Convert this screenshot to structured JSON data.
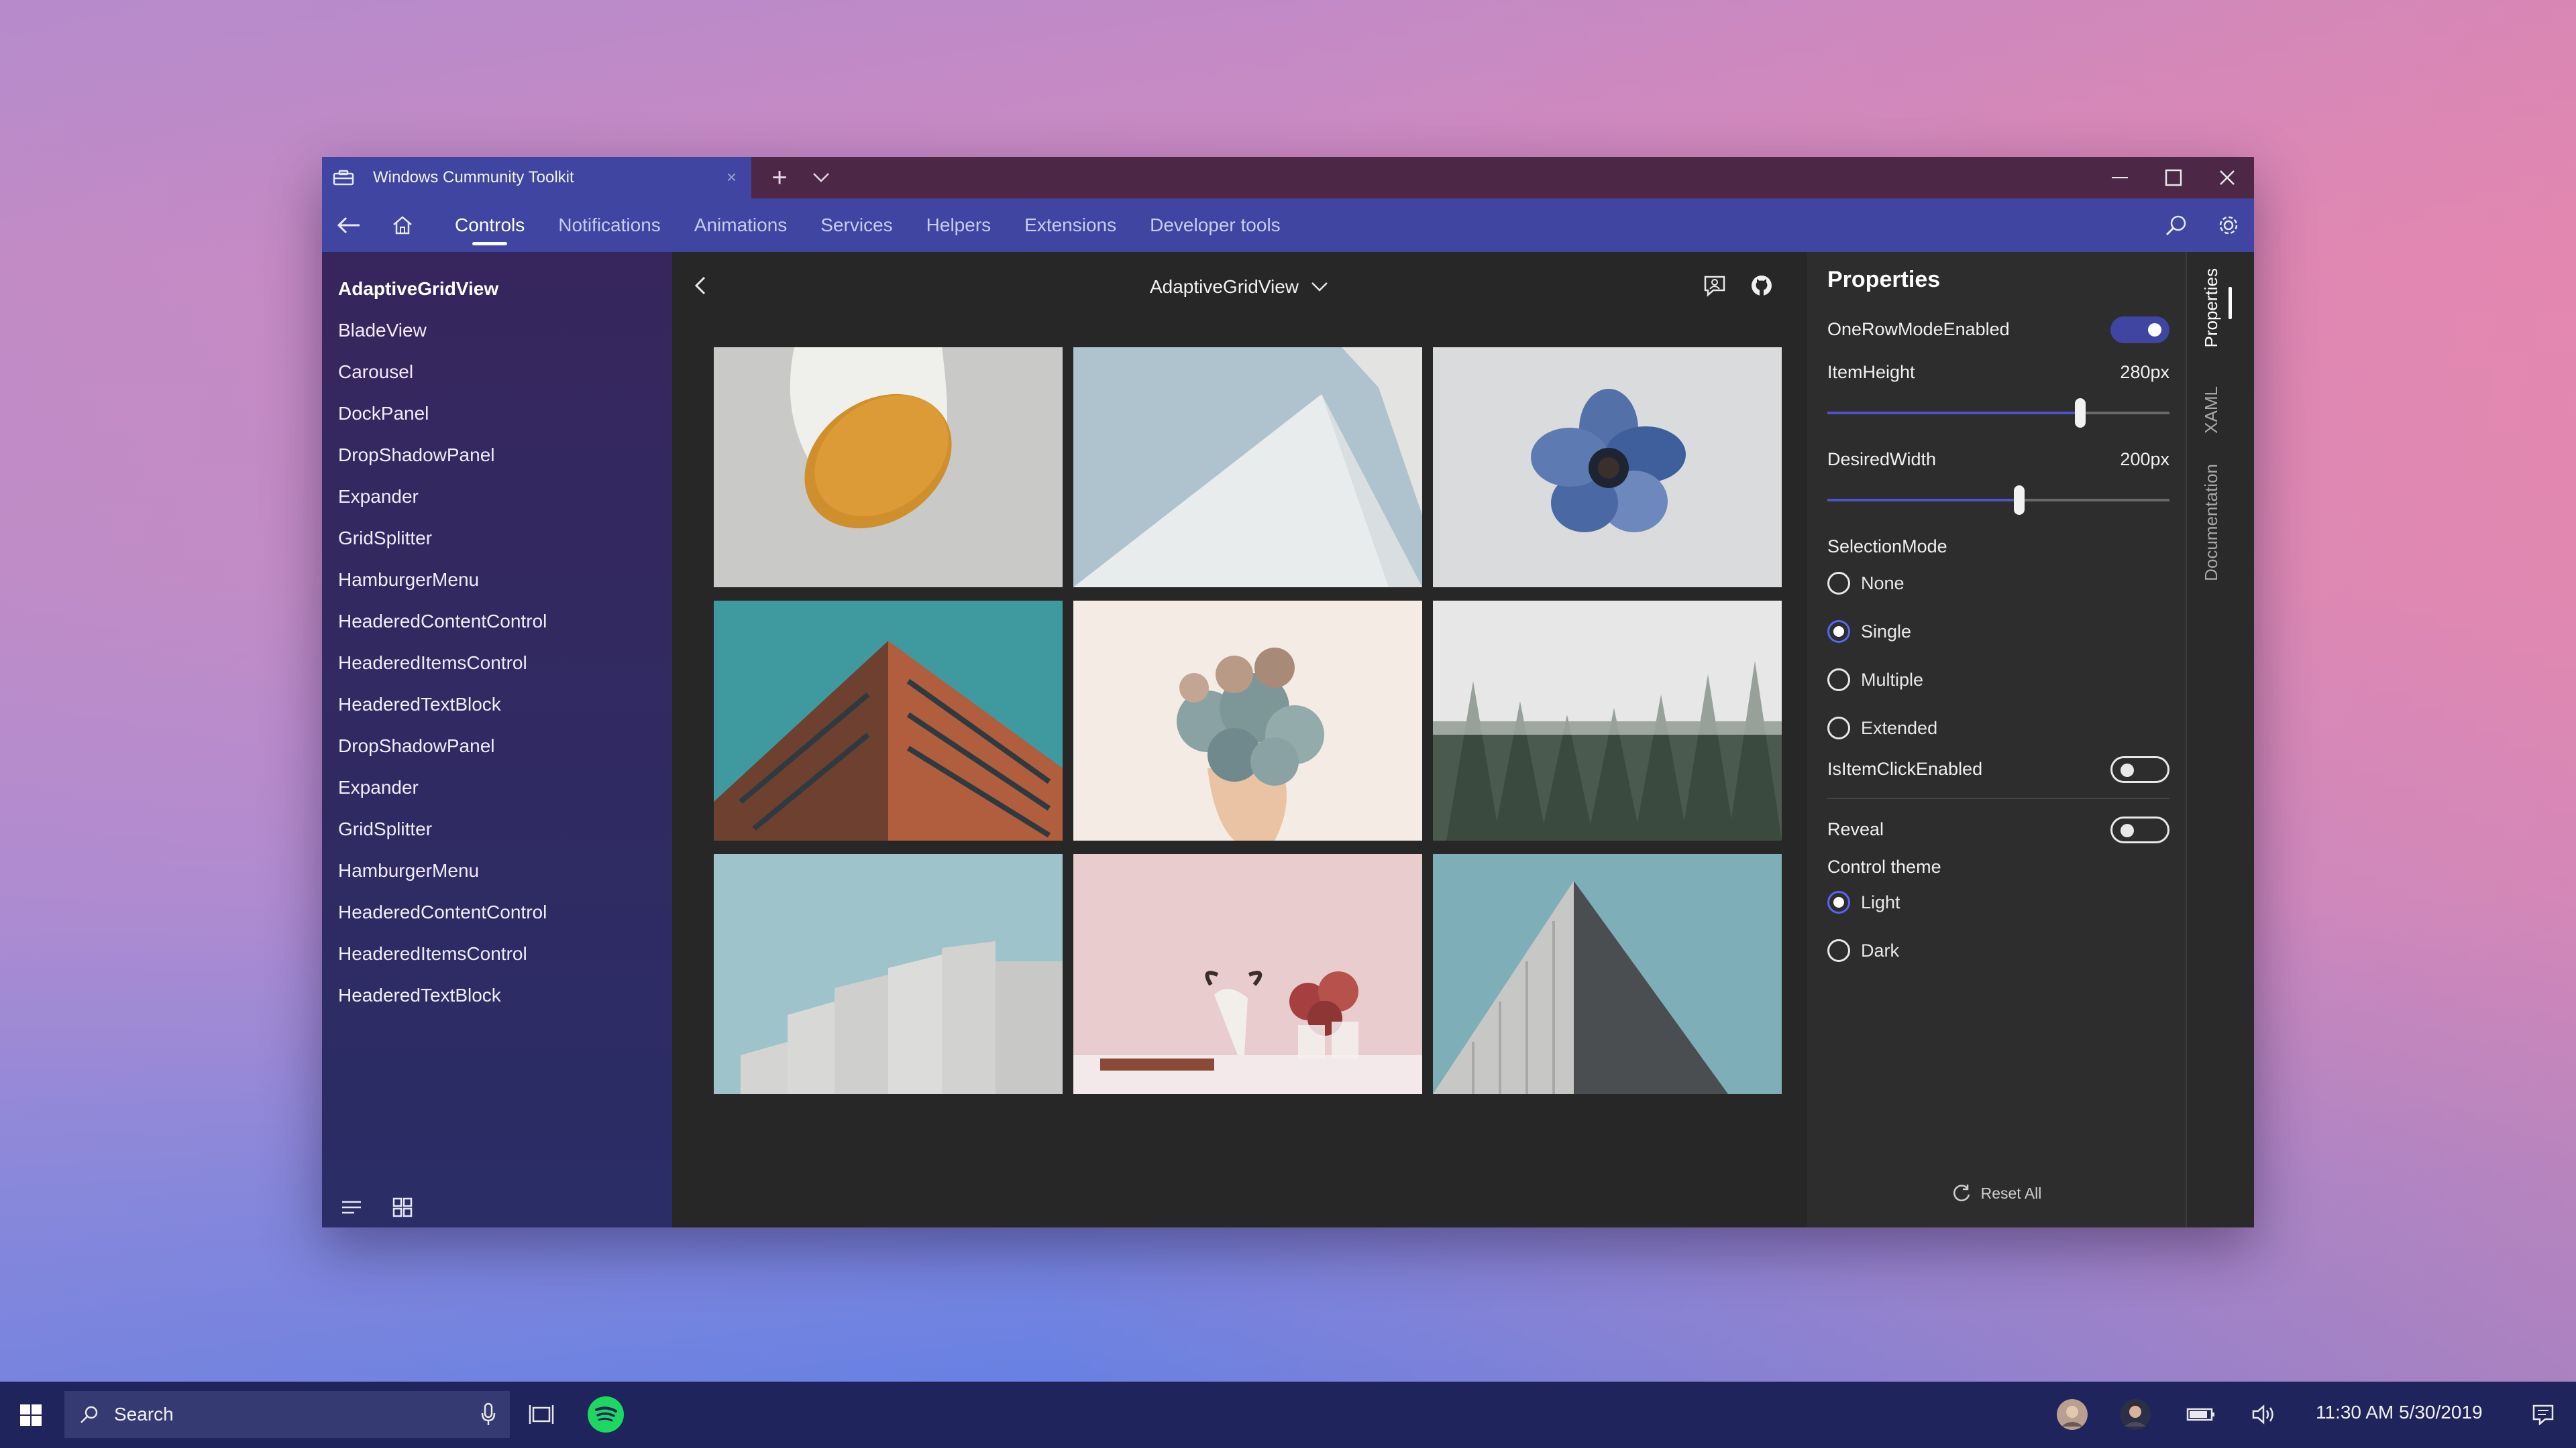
{
  "window": {
    "tab_title": "Windows Cummunity Toolkit",
    "accent_color": "#3f45a0",
    "titlebar_color": "#4d2746"
  },
  "nav": {
    "tabs": [
      "Controls",
      "Notifications",
      "Animations",
      "Services",
      "Helpers",
      "Extensions",
      "Developer tools"
    ],
    "active_tab": "Controls",
    "icons": [
      "back-arrow-icon",
      "home-icon",
      "search-icon",
      "gear-icon"
    ]
  },
  "sidebar": {
    "items": [
      "AdaptiveGridView",
      "BladeView",
      "Carousel",
      "DockPanel",
      "DropShadowPanel",
      "Expander",
      "GridSplitter",
      "HamburgerMenu",
      "HeaderedContentControl",
      "HeaderedItemsControl",
      "HeaderedTextBlock",
      "DropShadowPanel",
      "Expander",
      "GridSplitter",
      "HamburgerMenu",
      "HeaderedContentControl",
      "HeaderedItemsControl",
      "HeaderedTextBlock"
    ],
    "selected_index": 0
  },
  "content": {
    "sample_title": "AdaptiveGridView",
    "grid_items": [
      "yellow-lamp-photo",
      "white-pyramid-sky-photo",
      "blue-flower-photo",
      "brick-building-photo",
      "succulent-bouquet-photo",
      "foggy-forest-photo",
      "concrete-buildings-photo",
      "pink-still-life-photo",
      "white-triangle-building-photo"
    ]
  },
  "properties": {
    "title": "Properties",
    "one_row_mode_label": "OneRowModeEnabled",
    "one_row_mode_on": true,
    "item_height_label": "ItemHeight",
    "item_height_value": "280px",
    "item_height_fraction": 0.74,
    "desired_width_label": "DesiredWidth",
    "desired_width_value": "200px",
    "desired_width_fraction": 0.56,
    "selection_mode_label": "SelectionMode",
    "selection_modes": [
      "None",
      "Single",
      "Multiple",
      "Extended"
    ],
    "selected_mode": "Single",
    "is_item_click_label": "IsItemClickEnabled",
    "is_item_click_on": false,
    "reveal_label": "Reveal",
    "reveal_on": false,
    "control_theme_label": "Control theme",
    "themes": [
      "Light",
      "Dark"
    ],
    "selected_theme": "Light",
    "reset_label": "Reset All"
  },
  "pivot": {
    "tabs": [
      "Properties",
      "XAML",
      "Documentation"
    ],
    "active_tab": "Properties"
  },
  "taskbar": {
    "search_placeholder": "Search",
    "clock": "11:30 AM 5/30/2019"
  }
}
